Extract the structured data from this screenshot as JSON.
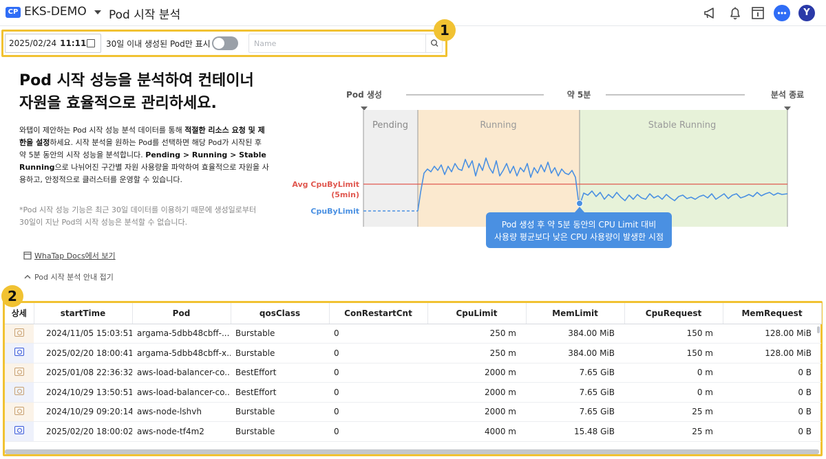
{
  "header": {
    "badge": "CP",
    "project": "EKS-DEMO",
    "title": "Pod 시작 분석",
    "avatar_letter": "Y",
    "icons": [
      "megaphone-icon",
      "bell-icon",
      "calendar-info-icon",
      "chat-icon",
      "avatar"
    ]
  },
  "filter": {
    "date": "2025/02/24",
    "time": "11:11",
    "toggle_label": "30일 이내 생성된 Pod만 표시",
    "toggle_on": false,
    "name_placeholder": "Name"
  },
  "badges": {
    "one": "1",
    "two": "2"
  },
  "intro": {
    "title_line1": "Pod 시작 성능을 분석하여 컨테이너",
    "title_line2": "자원을 효율적으로 관리하세요.",
    "p_a": "와탭이 제안하는 Pod 시작 성능 분석 데이터를 통해 ",
    "p_b": "적절한 리소스 요청 및 제한을 설정",
    "p_c": "하세요. 시작 분석을 원하는 Pod를 선택하면 해당 Pod가 시작된 후 약 5분 동안의 시작 성능을 분석합니다. ",
    "p_d": "Pending > Running > Stable Running",
    "p_e": "으로 나뉘어진 구간별 자원 사용량을 파악하여 효율적으로 자원을 사용하고, 안정적으로 클러스터를 운영할 수 있습니다.",
    "note": "*Pod 시작 성능 기능은 최근 30일 데이터를 이용하기 때문에 생성일로부터 30일이 지난 Pod의 시작 성능은 분석할 수 없습니다.",
    "docs_link": "WhaTap Docs에서 보기",
    "fold_link": "Pod 시작 분석 안내 접기"
  },
  "diagram": {
    "start_label": "Pod 생성",
    "mid_label": "약 5분",
    "end_label": "분석 종료",
    "phase_pending": "Pending",
    "phase_running": "Running",
    "phase_stable": "Stable Running",
    "avg_label_1": "Avg CpuByLimit",
    "avg_label_2": "(5min)",
    "cpu_label": "CpuByLimit",
    "tooltip_1": "Pod 생성 후 약 5분 동안의 CPU Limit 대비",
    "tooltip_2": "사용량 평균보다 낮은 CPU 사용량이 발생한 시점",
    "colors": {
      "pending": "#efefef",
      "running": "#fbe9cf",
      "stable": "#e7f2d9",
      "avg": "#e0574f",
      "cpu": "#4a90e2"
    }
  },
  "table": {
    "columns": [
      "상세",
      "startTime",
      "Pod",
      "qosClass",
      "ConRestartCnt",
      "CpuLimit",
      "MemLimit",
      "CpuRequest",
      "MemRequest"
    ],
    "rows": [
      {
        "icon": "detail-icon",
        "startTime": "2024/11/05 15:03:51",
        "pod": "argama-5dbb48cbff-...",
        "qos": "Burstable",
        "restart": "0",
        "cpuLimit": "250 m",
        "memLimit": "384.00 MiB",
        "cpuReq": "150 m",
        "memReq": "128.00 MiB"
      },
      {
        "icon": "detail-icon-active",
        "startTime": "2025/02/20 18:00:41",
        "pod": "argama-5dbb48cbff-x...",
        "qos": "Burstable",
        "restart": "0",
        "cpuLimit": "250 m",
        "memLimit": "384.00 MiB",
        "cpuReq": "150 m",
        "memReq": "128.00 MiB"
      },
      {
        "icon": "detail-icon",
        "startTime": "2025/01/08 22:36:32",
        "pod": "aws-load-balancer-co...",
        "qos": "BestEffort",
        "restart": "0",
        "cpuLimit": "2000 m",
        "memLimit": "7.65 GiB",
        "cpuReq": "0 m",
        "memReq": "0 B"
      },
      {
        "icon": "detail-icon",
        "startTime": "2024/10/29 13:50:51",
        "pod": "aws-load-balancer-co...",
        "qos": "BestEffort",
        "restart": "0",
        "cpuLimit": "2000 m",
        "memLimit": "7.65 GiB",
        "cpuReq": "0 m",
        "memReq": "0 B"
      },
      {
        "icon": "detail-icon",
        "startTime": "2024/10/29 09:20:14",
        "pod": "aws-node-lshvh",
        "qos": "Burstable",
        "restart": "0",
        "cpuLimit": "2000 m",
        "memLimit": "7.65 GiB",
        "cpuReq": "25 m",
        "memReq": "0 B"
      },
      {
        "icon": "detail-icon-active",
        "startTime": "2025/02/20 18:00:02",
        "pod": "aws-node-tf4m2",
        "qos": "Burstable",
        "restart": "0",
        "cpuLimit": "4000 m",
        "memLimit": "15.48 GiB",
        "cpuReq": "25 m",
        "memReq": "0 B"
      }
    ]
  }
}
